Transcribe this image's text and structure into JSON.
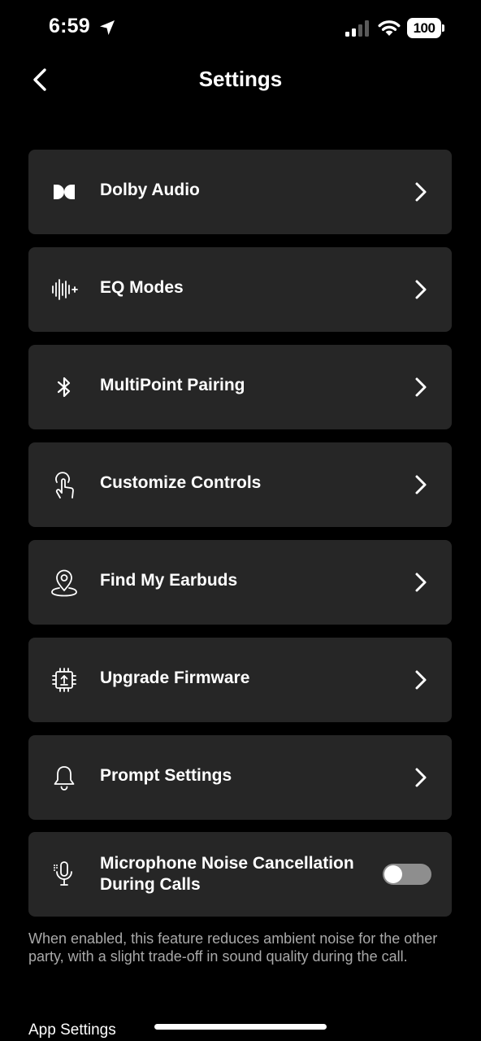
{
  "status_bar": {
    "time": "6:59",
    "battery": "100"
  },
  "nav": {
    "title": "Settings"
  },
  "items": [
    {
      "label": "Dolby Audio",
      "icon": "dolby-icon"
    },
    {
      "label": "EQ Modes",
      "icon": "waveform-icon"
    },
    {
      "label": "MultiPoint Pairing",
      "icon": "bluetooth-icon"
    },
    {
      "label": "Customize Controls",
      "icon": "tap-gesture-icon"
    },
    {
      "label": "Find My Earbuds",
      "icon": "location-pin-icon"
    },
    {
      "label": "Upgrade Firmware",
      "icon": "chip-upgrade-icon"
    },
    {
      "label": "Prompt Settings",
      "icon": "bell-icon"
    }
  ],
  "mic_setting": {
    "label": "Microphone Noise Cancellation During Calls",
    "icon": "microphone-icon",
    "enabled": false
  },
  "description": "When enabled, this feature reduces ambient noise for the other party, with a slight trade-off in sound quality during the call.",
  "section_header": "App Settings",
  "colors": {
    "background": "#000000",
    "card": "#262626",
    "text": "#ffffff",
    "secondary_text": "#a9a9a9",
    "toggle_off": "#8e8e8e"
  }
}
